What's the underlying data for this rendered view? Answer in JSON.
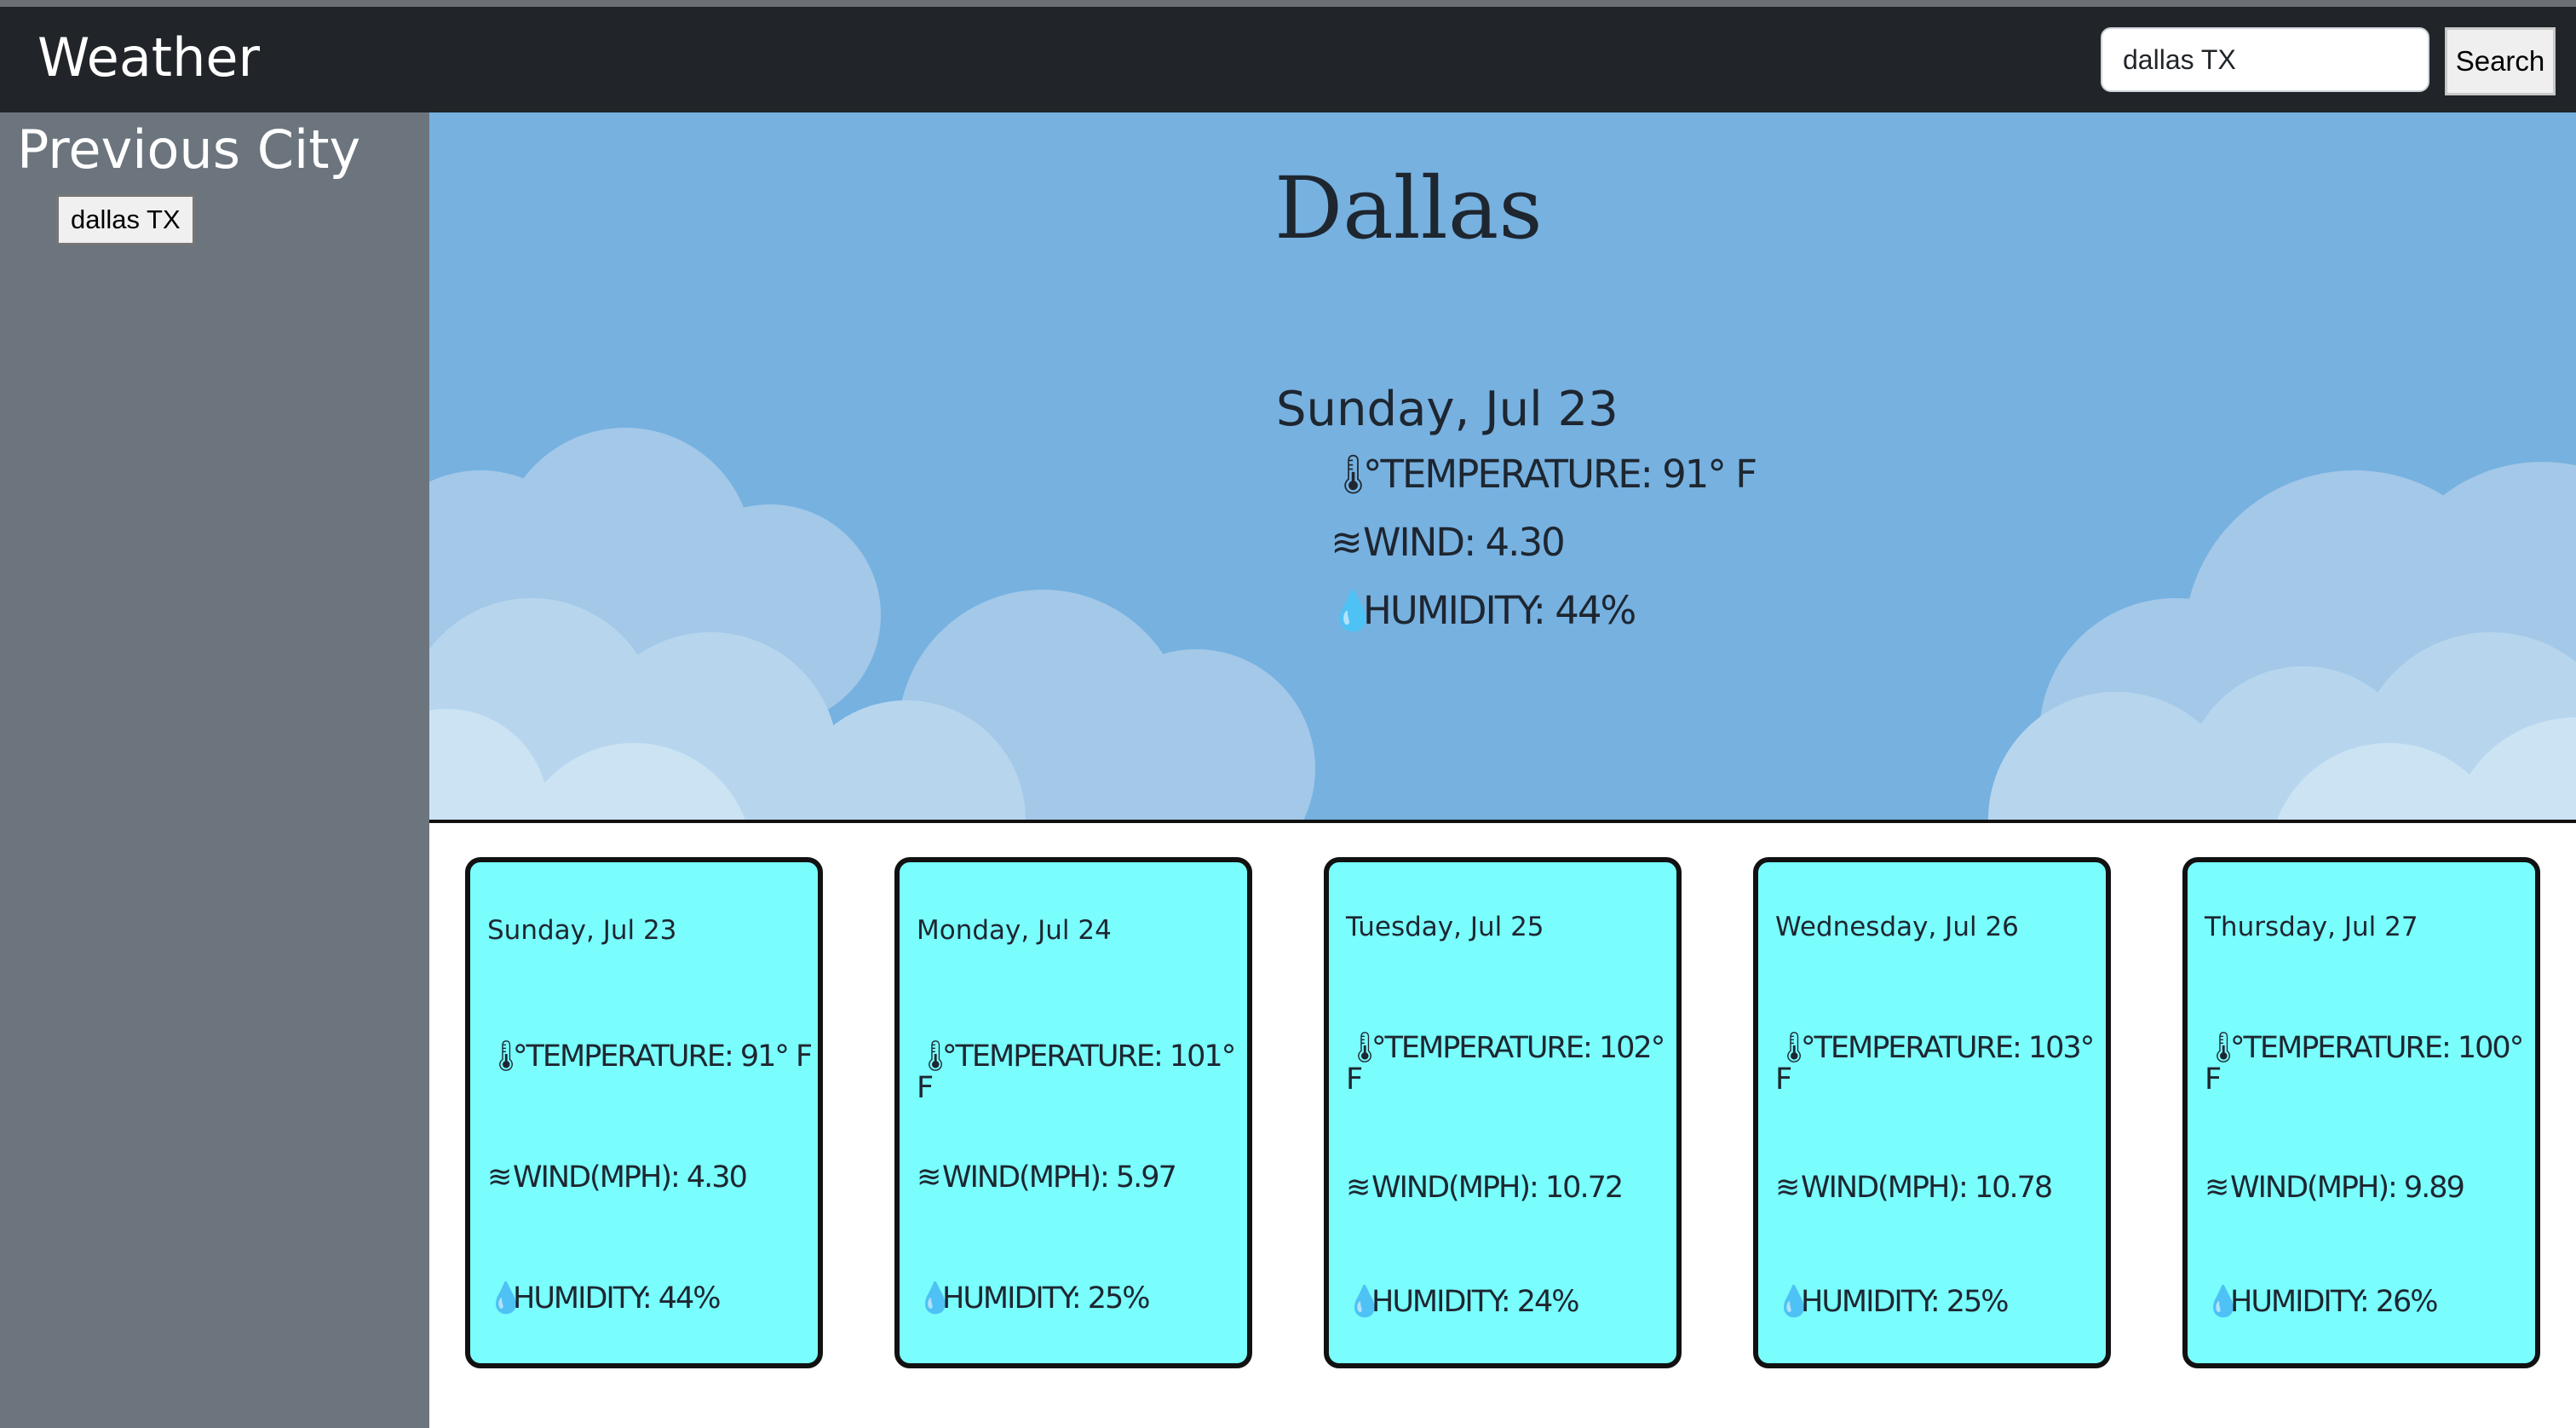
{
  "navbar": {
    "brand": "Weather",
    "search_value": "dallas TX",
    "search_button": "Search"
  },
  "sidebar": {
    "title": "Previous City",
    "history": [
      "dallas TX"
    ]
  },
  "current": {
    "city": "Dallas",
    "date": "Sunday, Jul 23",
    "temperature": "°TEMPERATURE: 91° F",
    "wind": "WIND: 4.30",
    "humidity": "HUMIDITY: 44%"
  },
  "icons": {
    "thermometer": "thermometer-icon",
    "wind": "wind-icon",
    "droplet": "droplet-icon"
  },
  "colors": {
    "navbar": "#212529",
    "sidebar": "#6c757d",
    "sky": "#76b1e0",
    "card": "#79fdfd"
  },
  "forecast": [
    {
      "date": "Sunday, Jul 23",
      "temperature": "°TEMPERATURE: 91° F",
      "wind": "WIND(MPH): 4.30",
      "humidity": "HUMIDITY: 44%"
    },
    {
      "date": "Monday, Jul 24",
      "temperature": "°TEMPERATURE: 101° F",
      "wind": "WIND(MPH): 5.97",
      "humidity": "HUMIDITY: 25%"
    },
    {
      "date": "Tuesday, Jul 25",
      "temperature": "°TEMPERATURE: 102° F",
      "wind": "WIND(MPH): 10.72",
      "humidity": "HUMIDITY: 24%"
    },
    {
      "date": "Wednesday, Jul 26",
      "temperature": "°TEMPERATURE: 103° F",
      "wind": "WIND(MPH): 10.78",
      "humidity": "HUMIDITY: 25%"
    },
    {
      "date": "Thursday, Jul 27",
      "temperature": "°TEMPERATURE: 100° F",
      "wind": "WIND(MPH): 9.89",
      "humidity": "HUMIDITY: 26%"
    }
  ]
}
